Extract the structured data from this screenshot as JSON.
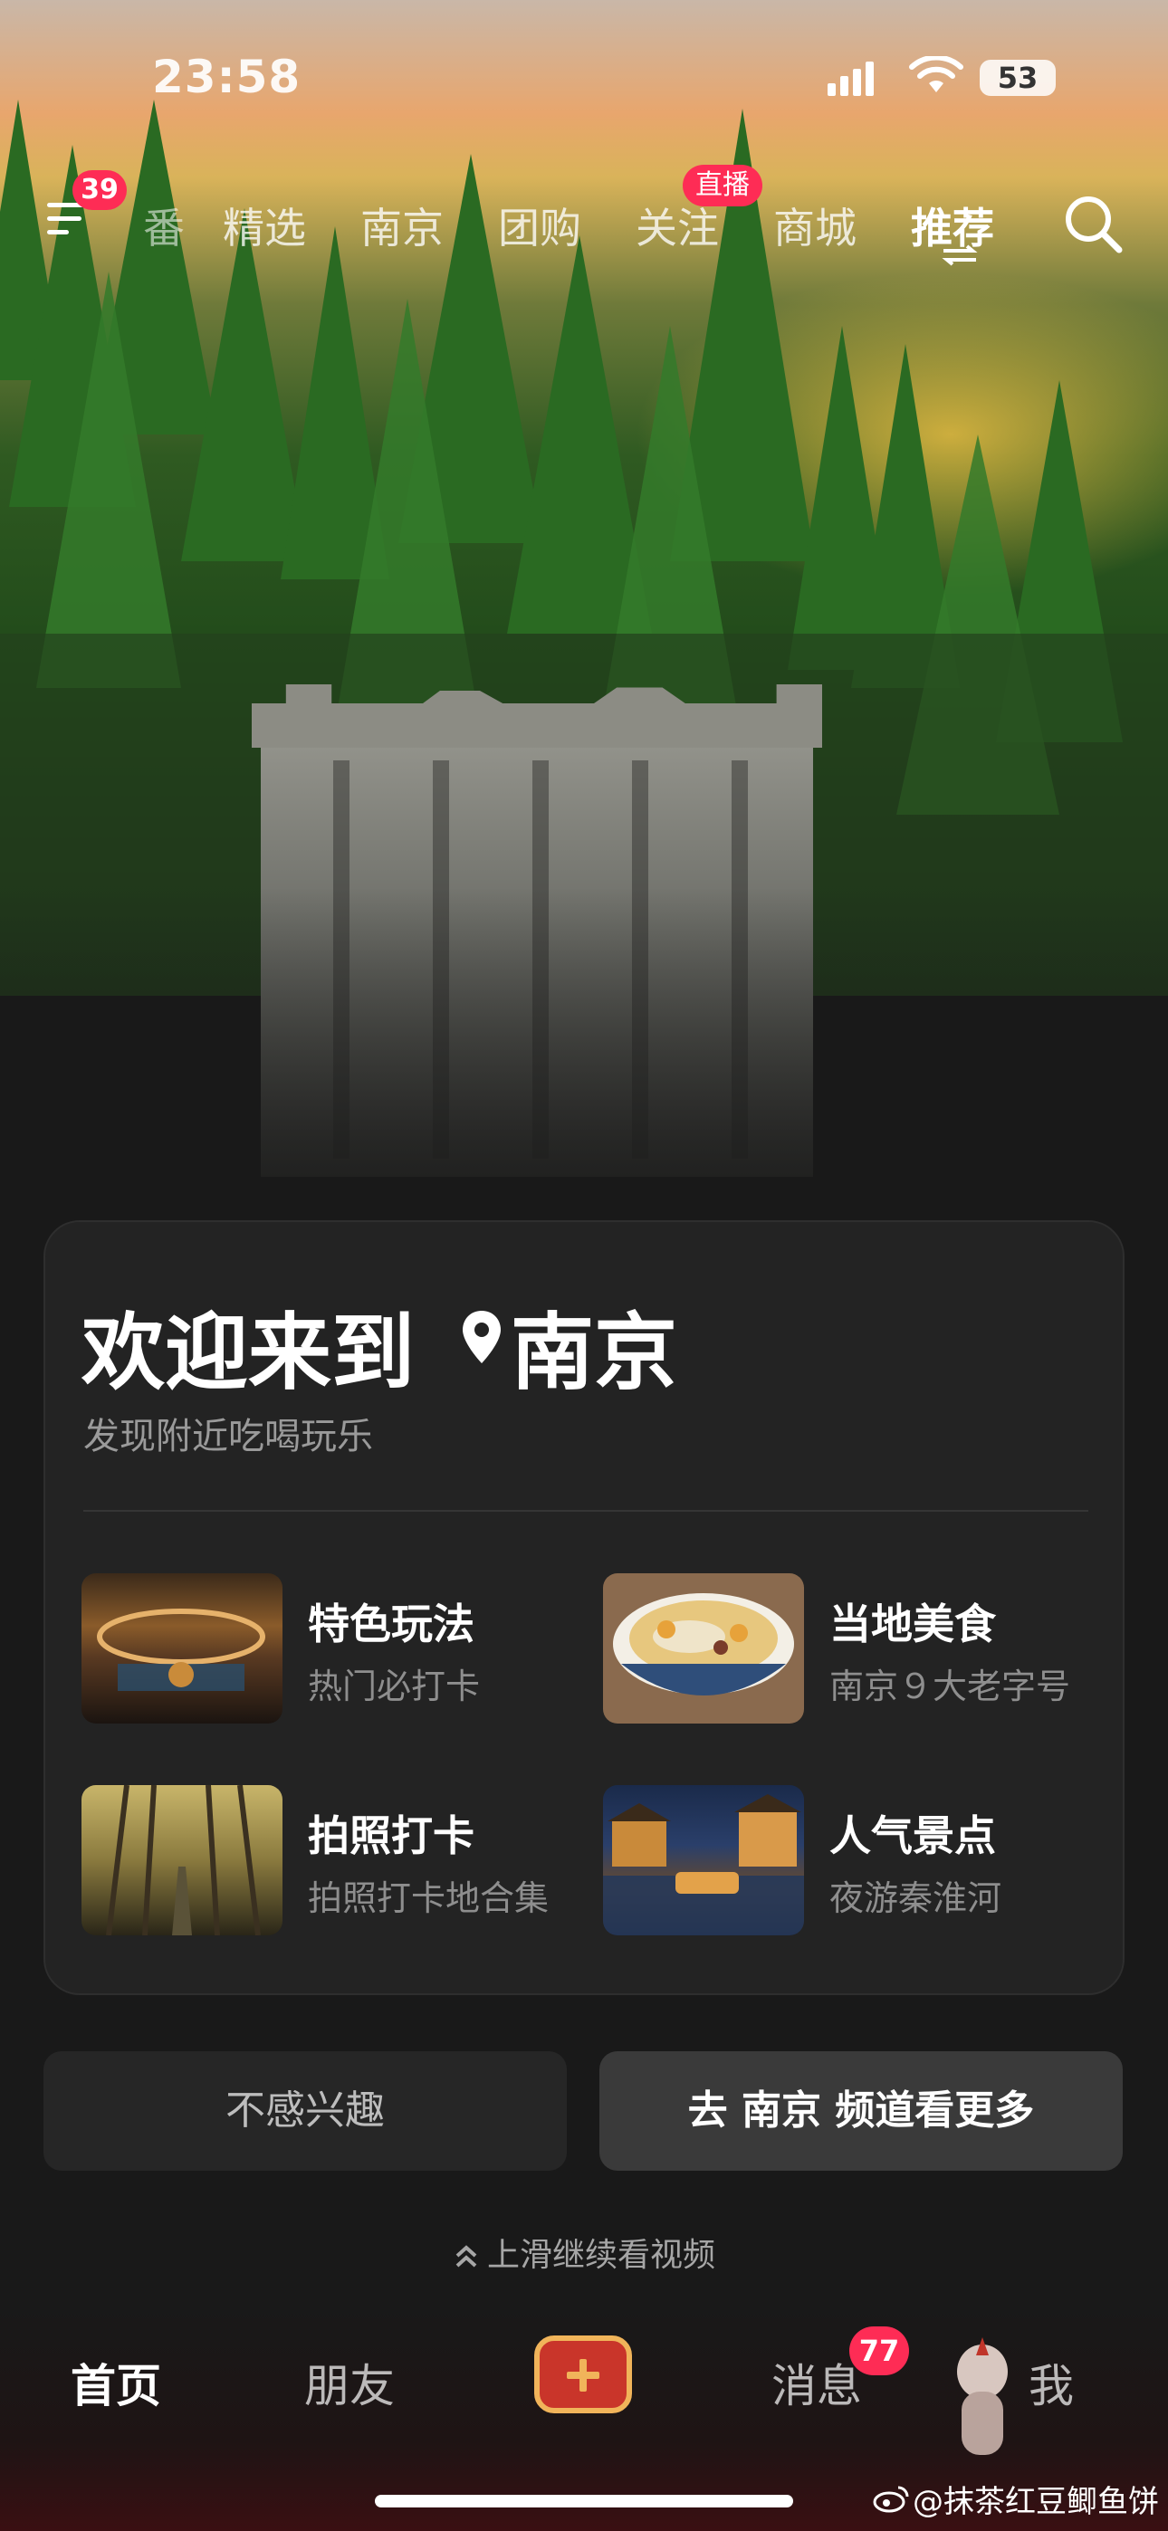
{
  "status_bar": {
    "time": "23:58",
    "battery": "53",
    "icons": [
      "cell-signal-icon",
      "wifi-icon",
      "battery-icon"
    ]
  },
  "top_nav": {
    "menu_badge": "39",
    "tabs": [
      {
        "label": "番"
      },
      {
        "label": "精选"
      },
      {
        "label": "南京"
      },
      {
        "label": "团购"
      },
      {
        "label": "关注",
        "badge": "直播"
      },
      {
        "label": "商城"
      },
      {
        "label": "推荐",
        "active": true
      }
    ],
    "icons": [
      "menu-icon",
      "search-icon"
    ]
  },
  "welcome_card": {
    "title": "欢迎来到",
    "city": "南京",
    "subtitle": "发现附近吃喝玩乐",
    "tiles": [
      {
        "title": "特色玩法",
        "subtitle": "热门必打卡"
      },
      {
        "title": "当地美食",
        "subtitle": "南京９大老字号"
      },
      {
        "title": "拍照打卡",
        "subtitle": "拍照打卡地合集"
      },
      {
        "title": "人气景点",
        "subtitle": "夜游秦淮河"
      }
    ]
  },
  "actions": {
    "not_interested": "不感兴趣",
    "go_channel": "去 南京 频道看更多"
  },
  "swipe_hint": "上滑继续看视频",
  "bottom_nav": {
    "home": "首页",
    "friends": "朋友",
    "messages": "消息",
    "messages_badge": "77",
    "me": "我"
  },
  "watermark": "@抹茶红豆鲫鱼饼",
  "colors": {
    "badge_red": "#fe2c55",
    "plus_red": "#c9352a",
    "plus_gold": "#f1b45a",
    "card_bg": "#232323"
  }
}
